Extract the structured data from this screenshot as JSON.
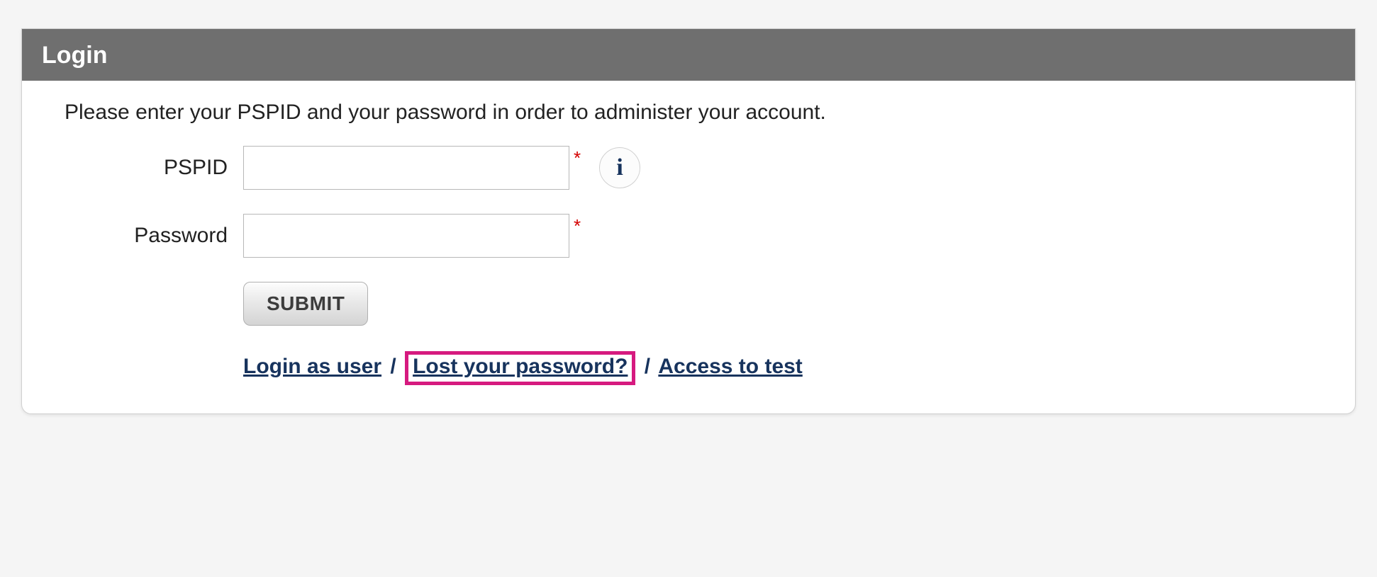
{
  "header": {
    "title": "Login"
  },
  "instruction": "Please enter your PSPID and your password in order to administer your account.",
  "fields": {
    "pspid": {
      "label": "PSPID",
      "value": "",
      "required_mark": "*",
      "info_icon_text": "i"
    },
    "password": {
      "label": "Password",
      "value": "",
      "required_mark": "*"
    }
  },
  "submit": {
    "label": "SUBMIT"
  },
  "links": {
    "login_as_user": "Login as user",
    "lost_password": "Lost your password?",
    "access_to_test": "Access to test",
    "separator": "/"
  }
}
